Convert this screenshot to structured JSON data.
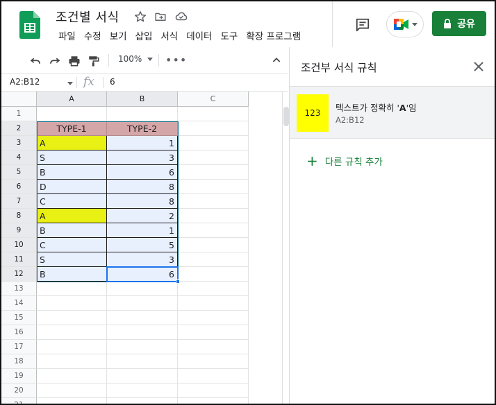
{
  "header": {
    "doc_title": "조건별 서식",
    "menu": [
      "파일",
      "수정",
      "보기",
      "삽입",
      "서식",
      "데이터",
      "도구",
      "확장 프로그램"
    ],
    "share_label": "공유"
  },
  "toolbar": {
    "zoom": "100%",
    "more": "•••"
  },
  "formula_bar": {
    "name_box": "A2:B12",
    "fx": "fx",
    "value": "6"
  },
  "grid": {
    "columns": [
      "A",
      "B",
      "C"
    ],
    "row_numbers": [
      "1",
      "2",
      "3",
      "4",
      "5",
      "6",
      "7",
      "8",
      "9",
      "10",
      "11",
      "12",
      "13",
      "14",
      "15",
      "16",
      "17",
      "18",
      "19",
      "20",
      "21"
    ],
    "header_row": [
      "TYPE-1",
      "TYPE-2"
    ],
    "rows": [
      [
        "A",
        "1"
      ],
      [
        "S",
        "3"
      ],
      [
        "B",
        "6"
      ],
      [
        "D",
        "8"
      ],
      [
        "C",
        "8"
      ],
      [
        "A",
        "2"
      ],
      [
        "B",
        "1"
      ],
      [
        "C",
        "5"
      ],
      [
        "S",
        "3"
      ],
      [
        "B",
        "6"
      ]
    ],
    "highlighted_rows": [
      0,
      5
    ],
    "colors": {
      "header_fill": "#d5a6a8",
      "data_fill": "#e8f0fe",
      "highlight_fill": "#e8f014",
      "selection": "#1a73e8"
    }
  },
  "side_panel": {
    "title": "조건부 서식 규칙",
    "rule": {
      "preview": "123",
      "desc_before": "텍스트가 정확히 '",
      "desc_value": "A",
      "desc_after": "'임",
      "range": "A2:B12",
      "preview_color": "#ffff00"
    },
    "add_rule": "다른 규칙 추가"
  },
  "icons": [
    "sheets-logo-icon",
    "star-icon",
    "move-folder-icon",
    "cloud-saved-icon",
    "comment-icon",
    "meet-icon",
    "lock-icon",
    "undo-icon",
    "redo-icon",
    "print-icon",
    "paint-format-icon",
    "chevron-up-icon",
    "close-icon",
    "plus-icon"
  ]
}
